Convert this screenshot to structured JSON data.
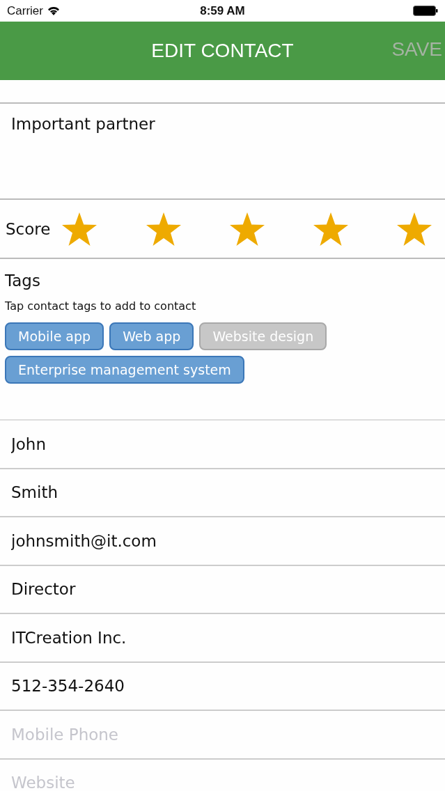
{
  "status_bar": {
    "carrier": "Carrier",
    "time": "8:59 AM"
  },
  "nav_bar": {
    "title": "EDIT CONTACT",
    "save": {
      "label": "SAVE",
      "disabled": true
    }
  },
  "note": {
    "value": "Important partner"
  },
  "score": {
    "label": "Score",
    "stars": 5
  },
  "tags": {
    "title": "Tags",
    "hint": "Tap contact tags to add to contact",
    "items": [
      {
        "label": "Mobile app",
        "selected": true
      },
      {
        "label": "Web app",
        "selected": true
      },
      {
        "label": "Website design",
        "selected": false
      },
      {
        "label": "Enterprise management system",
        "selected": true
      }
    ]
  },
  "fields": [
    {
      "value": "John"
    },
    {
      "value": "Smith"
    },
    {
      "value": "johnsmith@it.com"
    },
    {
      "value": "Director"
    },
    {
      "value": "ITCreation Inc."
    },
    {
      "value": "512-354-2640"
    },
    {
      "placeholder": "Mobile Phone"
    },
    {
      "placeholder": "Website"
    }
  ]
}
